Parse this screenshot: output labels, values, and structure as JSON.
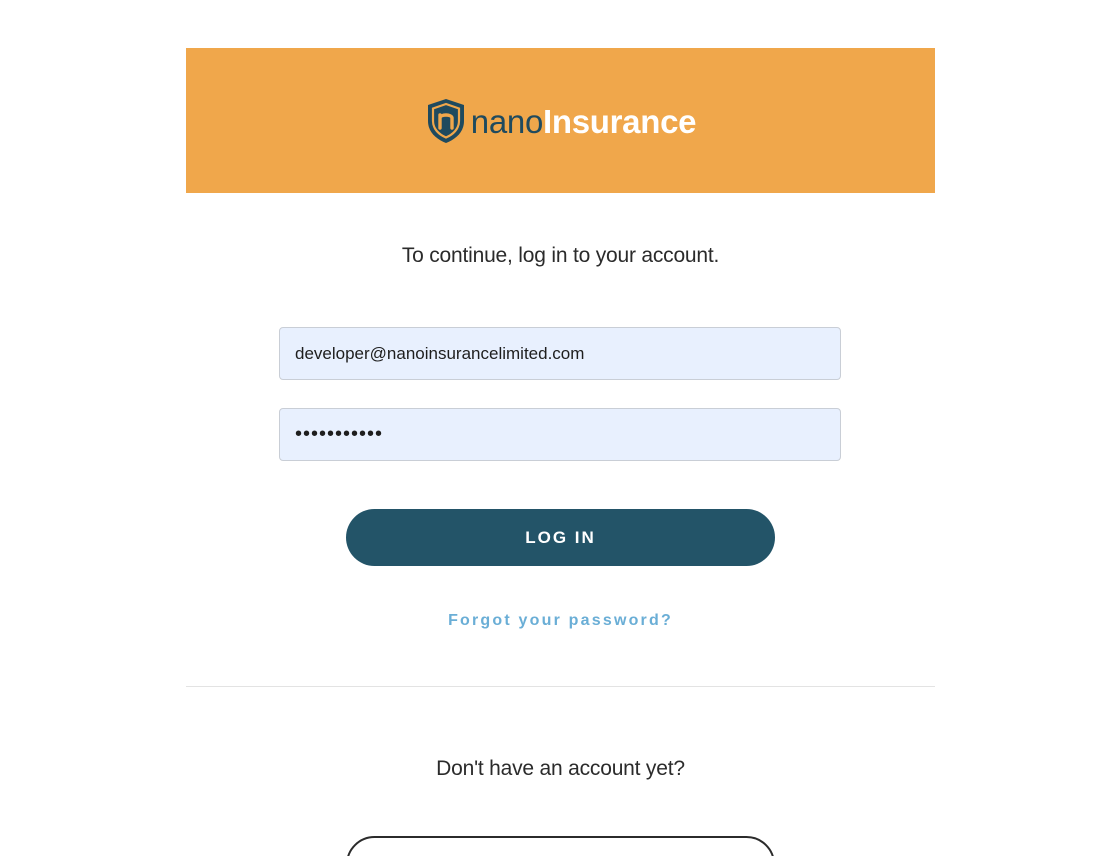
{
  "colors": {
    "brand_orange": "#f0a74b",
    "brand_dark": "#235468",
    "input_background": "#e8f0fe",
    "link_blue": "#6aaed6"
  },
  "header": {
    "logo_icon": "shield-n-icon",
    "logo_part_1": "nano",
    "logo_part_2": "Insurance"
  },
  "login": {
    "prompt": "To continue, log in to your account.",
    "email_value": "developer@nanoinsurancelimited.com",
    "password_value": "•••••••••••",
    "login_label": "LOG IN",
    "forgot_label": "Forgot your password?"
  },
  "signup": {
    "prompt": "Don't have an account yet?"
  }
}
